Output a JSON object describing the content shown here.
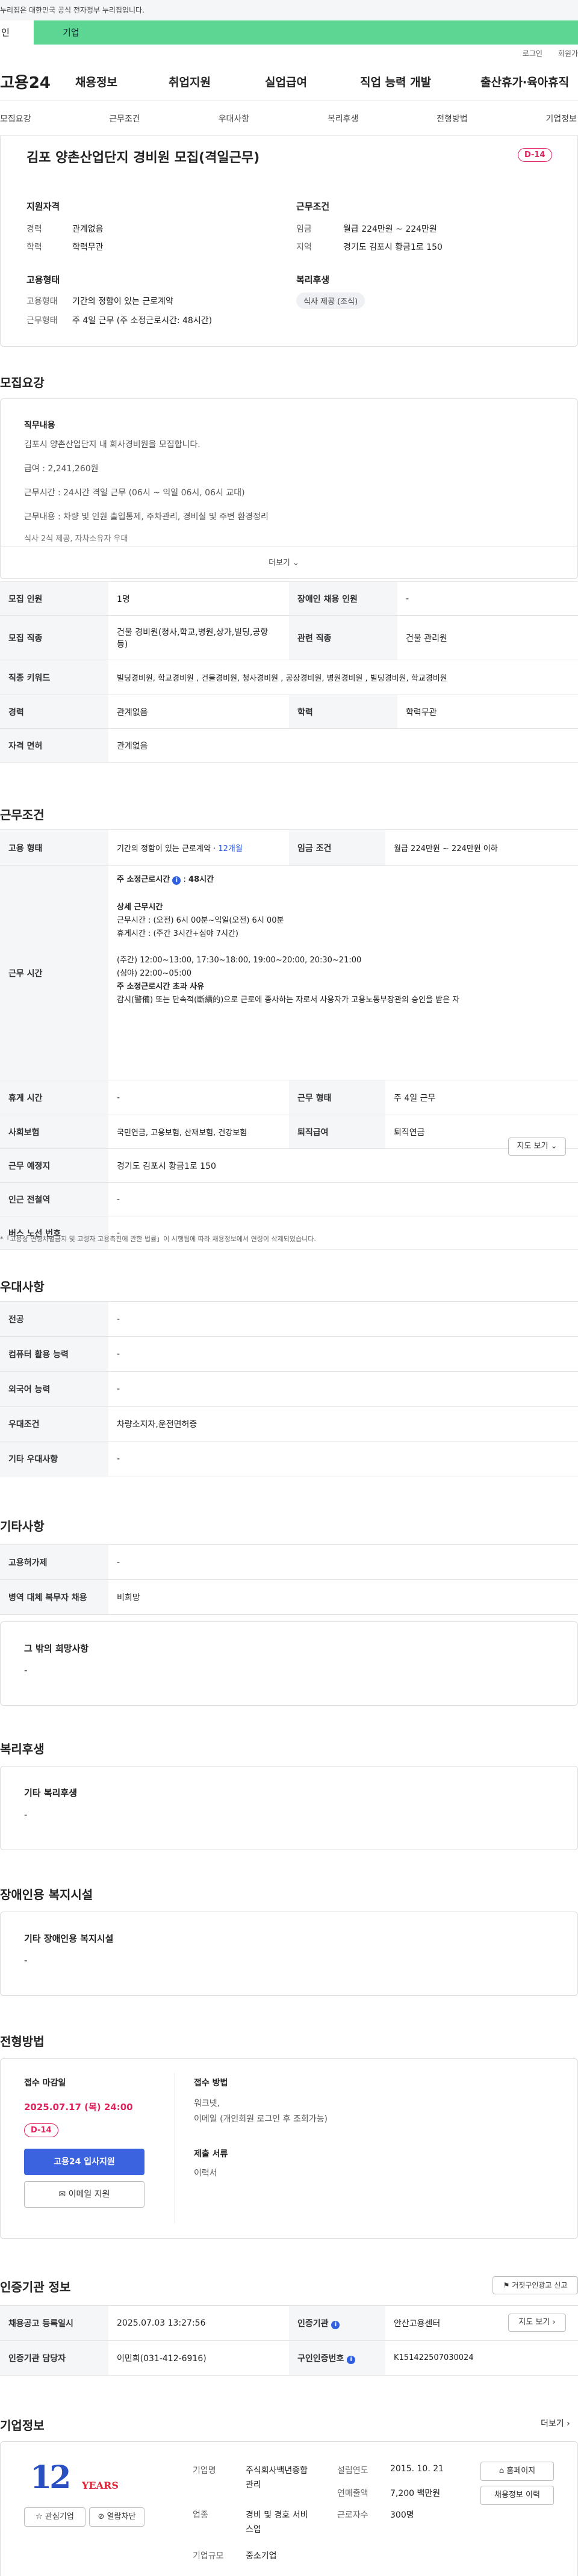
{
  "topbar": {
    "notice": "누리집은 대한민국 공식 전자정부 누리집입니다."
  },
  "usertype": {
    "personal": "인",
    "company": "기업"
  },
  "header": {
    "login": "로그인",
    "join": "회원가"
  },
  "gnb": {
    "logo": "고용24",
    "items": [
      "채용정보",
      "취업지원",
      "실업급여",
      "직업 능력 개발",
      "출산휴가·육아휴직"
    ]
  },
  "tabs": [
    "모집요강",
    "근무조건",
    "우대사항",
    "복리후생",
    "전형방법",
    "기업정보"
  ],
  "job": {
    "title": "김포 양촌산업단지 경비원 모집(격일근무)",
    "dday": "D-14",
    "qual": {
      "heading": "지원자격",
      "career_k": "경력",
      "career_v": "관계없음",
      "edu_k": "학력",
      "edu_v": "학력무관"
    },
    "cond": {
      "heading": "근무조건",
      "wage_k": "임금",
      "wage_v": "월급 224만원 ~ 224만원",
      "area_k": "지역",
      "area_v": "경기도 김포시 황금1로 150"
    },
    "emp": {
      "heading": "고용형태",
      "type_k": "고용형태",
      "type_v": "기간의 정함이 있는 근로계약",
      "hours_k": "근무형태",
      "hours_v": "주 4일 근무 (주 소정근로시간: 48시간)"
    },
    "welfare": {
      "heading": "복리후생",
      "tag": "식사 제공 (조식)"
    }
  },
  "recruit": {
    "heading": "모집요강",
    "duty_h": "직무내용",
    "lines": [
      "김포시 양촌산업단지 내 회사경비원을 모집합니다.",
      "급여 : 2,241,260원",
      "근무시간 : 24시간 격일 근무 (06시 ~ 익일 06시, 06시 교대)",
      "근무내용 : 차량 및 인원 출입통제, 주차관리, 경비실 및 주변 환경정리",
      "식사 2식 제공, 자차소유자 우대"
    ],
    "more": "더보기",
    "table": [
      [
        "모집 인원",
        "1명",
        "장애인 채용 인원",
        "-"
      ],
      [
        "모집 직종",
        "건물 경비원(청사,학교,병원,상가,빌딩,공항 등)",
        "관련 직종",
        "건물 관리원"
      ],
      [
        "직종 키워드",
        "빌딩경비원, 학교경비원 , 건물경비원, 청사경비원 , 공장경비원, 병원경비원 , 빌딩경비원, 학교경비원",
        "",
        ""
      ],
      [
        "경력",
        "관계없음",
        "학력",
        "학력무관"
      ],
      [
        "자격 면허",
        "관계없음",
        "",
        ""
      ]
    ]
  },
  "workcond": {
    "heading": "근무조건",
    "emp_k": "고용 형태",
    "emp_v": "기간의 정함이 있는 근로계약",
    "emp_dur": "12개월",
    "wage_k": "임금 조건",
    "wage_v": "월급 224만원 ~ 224만원 이하",
    "hours_k": "근무 시간",
    "hours_lines": [
      "주 소정근로시간",
      "48시간",
      "상세 근무시간",
      "근무시간 : (오전) 6시 00분~익일(오전) 6시 00분",
      "휴게시간 : (주간 3시간+심야 7시간)",
      "(주간) 12:00~13:00, 17:30~18:00, 19:00~20:00, 20:30~21:00",
      "(심야) 22:00~05:00",
      "주 소정근로시간 초과 사유",
      "감시(警備) 또는 단속적(斷續的)으로 근로에 종사하는 자로서 사용자가 고용노동부장관의 승인을 받은 자"
    ],
    "rest_k": "휴게 시간",
    "rest_v": "-",
    "form_k": "근무 형태",
    "form_v": "주 4일 근무",
    "ins_k": "사회보험",
    "ins_v": "국민연금, 고용보험, 산재보험, 건강보험",
    "ret_k": "퇴직급여",
    "ret_v": "퇴직연금",
    "place_k": "근무 예정지",
    "place_v": "경기도 김포시 황금1로 150",
    "map": "지도 보기",
    "sub_k": "인근 전철역",
    "sub_v": "-",
    "bus_k": "버스 노선 번호",
    "bus_v": "-",
    "note": "*「고용상 연령차별금지 및 고령자 고용촉진에 관한 법률」이 시행됨에 따라 채용정보에서 연령이 삭제되었습니다."
  },
  "pref": {
    "heading": "우대사항",
    "rows": [
      [
        "전공",
        "-"
      ],
      [
        "컴퓨터 활용 능력",
        "-"
      ],
      [
        "외국어 능력",
        "-"
      ],
      [
        "우대조건",
        "차량소지자,운전면허증"
      ],
      [
        "기타 우대사항",
        "-"
      ]
    ]
  },
  "etc": {
    "heading": "기타사항",
    "rows": [
      [
        "고용허가제",
        "-"
      ],
      [
        "병역 대체 복무자 채용",
        "비희망"
      ]
    ],
    "box_h": "그 밖의 희망사항",
    "box_v": "-"
  },
  "welfare": {
    "heading": "복리후생",
    "box_h": "기타 복리후생",
    "box_v": "-"
  },
  "disability": {
    "heading": "장애인용 복지시설",
    "box_h": "기타 장애인용 복지시설",
    "box_v": "-"
  },
  "select": {
    "heading": "전형방법",
    "deadline_h": "접수 마감일",
    "deadline_v": "2025.07.17 (목) 24:00",
    "dday": "D-14",
    "apply": "고용24 입사지원",
    "email": "이메일 지원",
    "method_h": "접수 방법",
    "method_v1": "워크넷,",
    "method_v2": "이메일 (개인회원 로그인 후 조회가능)",
    "docs_h": "제출 서류",
    "docs_v": "이력서"
  },
  "cert": {
    "heading": "인증기관 정보",
    "report": "거짓구인광고 신고",
    "rows": [
      [
        "채용공고 등록일시",
        "2025.07.03 13:27:56",
        "인증기관",
        "안산고용센터"
      ],
      [
        "인증기관 담당자",
        "이민희(031-412-6916)",
        "구인인증번호",
        "K151422507030024"
      ]
    ],
    "map": "지도 보기"
  },
  "company": {
    "heading": "기업정보",
    "more": "더보기",
    "logo_num": "12",
    "logo_txt": "YEARS",
    "fav": "관심기업",
    "block": "열람차단",
    "name_k": "기업명",
    "name_v1": "주식회사백년종합",
    "name_v2": "관리",
    "ind_k": "업종",
    "ind_v1": "경비 및 경호 서비",
    "ind_v2": "스업",
    "size_k": "기업규모",
    "size_v": "중소기업",
    "est_k": "설립연도",
    "est_v": "2015. 10. 21",
    "sales_k": "연매출액",
    "sales_v": "7,200 백만원",
    "emp_k": "근로자수",
    "emp_v": "300명",
    "home": "홈페이지",
    "history": "채용정보 이력"
  }
}
